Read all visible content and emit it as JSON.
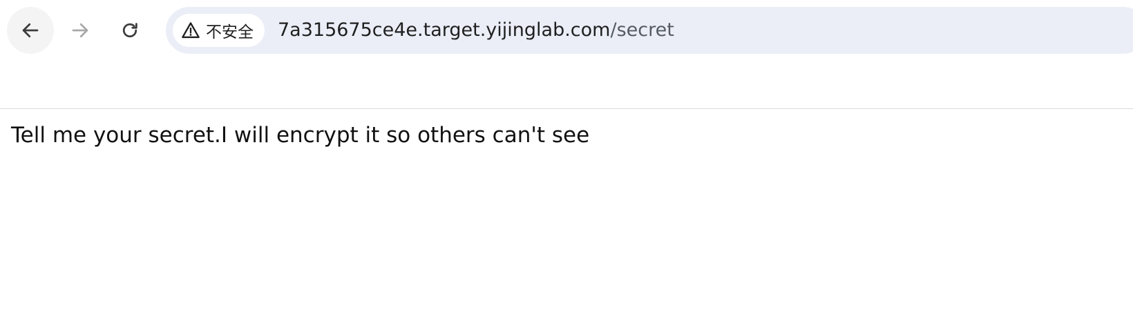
{
  "browser": {
    "security_chip": {
      "icon": "warning-triangle-icon",
      "label": "不安全"
    },
    "address_bar": {
      "host": "7a315675ce4e.target.yijinglab.com",
      "path": "/secret"
    },
    "nav": {
      "back_icon": "arrow-left-icon",
      "forward_icon": "arrow-right-icon",
      "reload_icon": "reload-icon"
    },
    "colors": {
      "omnibox_bg": "#ebeef7",
      "page_bg": "#ffffff",
      "text": "#111111"
    }
  },
  "page": {
    "message": "Tell me your secret.I will encrypt it so others can't see"
  }
}
